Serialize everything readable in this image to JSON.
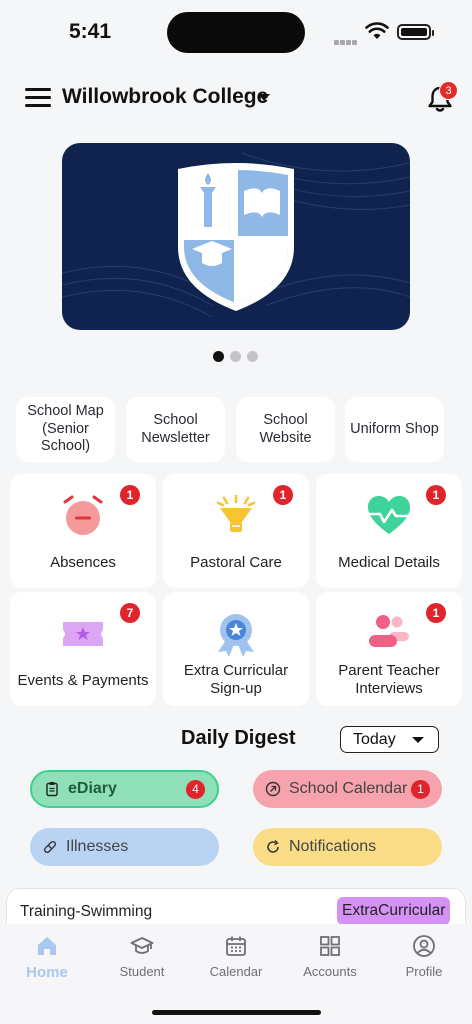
{
  "status_bar": {
    "time": "5:41"
  },
  "header": {
    "school_name": "Willowbrook College",
    "notification_count": "3"
  },
  "carousel": {
    "pages": 3,
    "active_page": 1
  },
  "quick_links": [
    {
      "label": "School Map (Senior School)"
    },
    {
      "label": "School Newsletter"
    },
    {
      "label": "School Website"
    },
    {
      "label": "Uniform Shop"
    }
  ],
  "tiles": [
    {
      "label": "Absences",
      "badge": "1",
      "icon": "alarm-clock-icon"
    },
    {
      "label": "Pastoral Care",
      "badge": "1",
      "icon": "funnel-light-icon"
    },
    {
      "label": "Medical Details",
      "badge": "1",
      "icon": "heart-pulse-icon"
    },
    {
      "label": "Events & Payments",
      "badge": "7",
      "icon": "ticket-icon"
    },
    {
      "label": "Extra Curricular Sign-up",
      "badge": "",
      "icon": "award-ribbon-icon"
    },
    {
      "label": "Parent Teacher Interviews",
      "badge": "1",
      "icon": "people-chat-icon"
    }
  ],
  "digest": {
    "title": "Daily Digest",
    "range_selected": "Today",
    "filters": [
      {
        "label": "eDiary",
        "count": "4",
        "color": "#8fe0b8",
        "icon": "clipboard-icon"
      },
      {
        "label": "School Calendar",
        "count": "1",
        "color": "#f6a3ad",
        "icon": "calendar-icon"
      },
      {
        "label": "Illnesses",
        "count": "",
        "color": "#b9d3f3",
        "icon": "pill-icon"
      },
      {
        "label": "Notifications",
        "count": "",
        "color": "#fbdd88",
        "icon": "refresh-icon"
      }
    ],
    "items": [
      {
        "title": "Training-Swimming",
        "tag": "ExtraCurricular"
      }
    ]
  },
  "tabbar": [
    {
      "label": "Home",
      "icon": "home-icon",
      "active": true
    },
    {
      "label": "Student",
      "icon": "graduation-cap-icon",
      "active": false
    },
    {
      "label": "Calendar",
      "icon": "calendar-icon",
      "active": false
    },
    {
      "label": "Accounts",
      "icon": "grid-icon",
      "active": false
    },
    {
      "label": "Profile",
      "icon": "user-circle-icon",
      "active": false
    }
  ],
  "colors": {
    "accent": "#a9c8ef",
    "badge": "#e0242b",
    "banner": "#10234f"
  }
}
